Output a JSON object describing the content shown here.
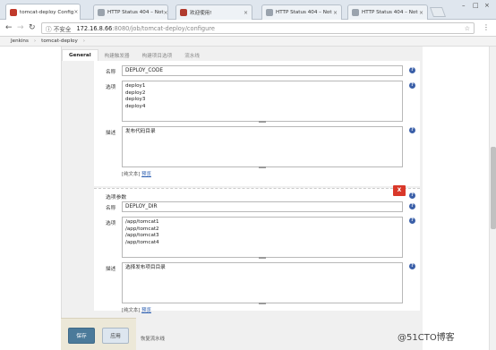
{
  "browser": {
    "tabs": [
      {
        "title": "tomcat-deploy Config",
        "active": true,
        "fav_color": "#c0392b"
      },
      {
        "title": "HTTP Status 404 – Not",
        "active": false,
        "fav_color": "#9aa3ad"
      },
      {
        "title": "欢迎使用!",
        "active": false,
        "fav_color": "#b03a2e"
      },
      {
        "title": "HTTP Status 404 – Not",
        "active": false,
        "fav_color": "#9aa3ad"
      },
      {
        "title": "HTTP Status 404 – Not",
        "active": false,
        "fav_color": "#9aa3ad"
      }
    ],
    "close_glyph": "×",
    "window_controls": [
      "–",
      "□",
      "×"
    ],
    "address": {
      "insecure_label": "ⓘ 不安全",
      "host": "172.16.8.66",
      "path": ":8080/job/tomcat-deploy/configure"
    },
    "nav_icons": [
      "back-icon",
      "forward-icon",
      "reload-icon"
    ]
  },
  "breadcrumb": {
    "items": [
      "Jenkins",
      "tomcat-deploy"
    ],
    "separator": "›"
  },
  "section_tabs": [
    "General",
    "构建触发器",
    "构建项目选项",
    "流水线"
  ],
  "param1": {
    "name_label": "名称",
    "name_value": "DEPLOY_CODE",
    "options_label": "选项",
    "options": [
      "deploy1",
      "deploy2",
      "deploy3",
      "deploy4"
    ],
    "desc_label": "描述",
    "desc_value": "发布代码目录",
    "note_prefix": "[纯文本]",
    "note_link": "预览"
  },
  "param2": {
    "title": "选项参数",
    "delete_label": "X",
    "name_label": "名称",
    "name_value": "DEPLOY_DIR",
    "options_label": "选项",
    "options": [
      "/app/tomcat1",
      "/app/tomcat2",
      "/app/tomcat3",
      "/app/tomcat4"
    ],
    "desc_label": "描述",
    "desc_value": "选择发布项目目录",
    "note_prefix": "[纯文本]",
    "note_link": "预览"
  },
  "footer": {
    "save": "保存",
    "apply": "应用",
    "hint": "恢复流水线"
  },
  "help_glyph": "?",
  "watermark": "@51CTO博客",
  "colors": {
    "accent": "#4b7a9a",
    "delete": "#d9382a",
    "help": "#3a5fa8"
  }
}
